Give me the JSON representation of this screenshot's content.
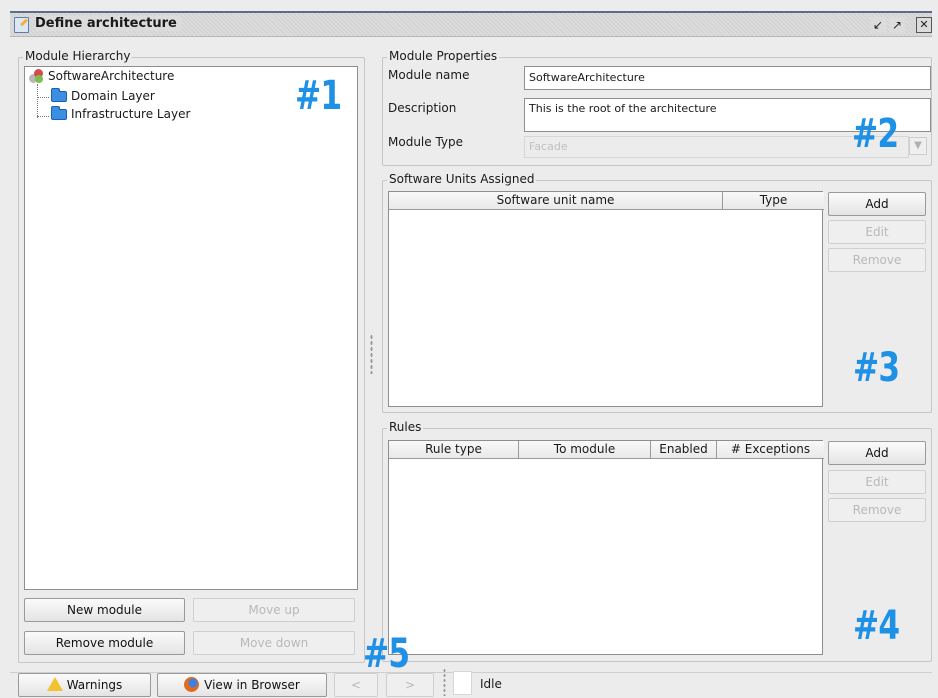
{
  "window": {
    "title": "Define architecture",
    "minimize_icon": "minimize-icon",
    "maximize_icon": "maximize-icon",
    "close_icon": "close-icon"
  },
  "module_hierarchy": {
    "legend": "Module Hierarchy",
    "root": "SoftwareArchitecture",
    "children": [
      "Domain Layer",
      "Infrastructure Layer"
    ],
    "buttons": {
      "new_module": "New module",
      "move_up": "Move up",
      "remove_module": "Remove module",
      "move_down": "Move down"
    }
  },
  "module_properties": {
    "legend": "Module Properties",
    "name_label": "Module name",
    "name_value": "SoftwareArchitecture",
    "description_label": "Description",
    "description_value": "This is the root of the architecture",
    "type_label": "Module Type",
    "type_value": "Facade"
  },
  "software_units": {
    "legend": "Software Units Assigned",
    "columns": [
      "Software unit name",
      "Type"
    ],
    "rows": [],
    "buttons": {
      "add": "Add",
      "edit": "Edit",
      "remove": "Remove"
    }
  },
  "rules": {
    "legend": "Rules",
    "columns": [
      "Rule type",
      "To module",
      "Enabled",
      "# Exceptions"
    ],
    "rows": [],
    "buttons": {
      "add": "Add",
      "edit": "Edit",
      "remove": "Remove"
    }
  },
  "status_bar": {
    "warnings": "Warnings",
    "view_in_browser": "View in Browser",
    "prev": "<",
    "next": ">",
    "status": "Idle"
  },
  "annotations": [
    "#1",
    "#2",
    "#3",
    "#4",
    "#5"
  ],
  "colors": {
    "annotation": "#1e90e6",
    "title_bar_accent": "#5a6d8c"
  }
}
